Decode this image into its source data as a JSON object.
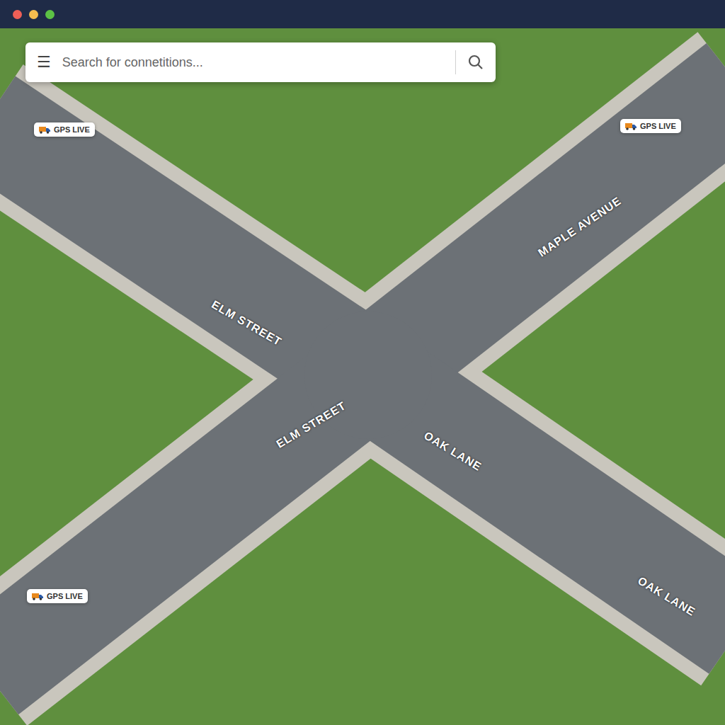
{
  "window": {
    "controls": [
      {
        "name": "close",
        "color": "#ee5f57"
      },
      {
        "name": "minimize",
        "color": "#f5bd4f"
      },
      {
        "name": "maximize",
        "color": "#5cc245"
      }
    ]
  },
  "search": {
    "menu": "☰",
    "placeholder": "Search for connetitions..."
  },
  "badges": [
    {
      "label": "GPS LIVE"
    },
    {
      "label": "GPS LIVE"
    },
    {
      "label": "GPS LIVE"
    }
  ],
  "streets": [
    {
      "label": "ELM STREET"
    },
    {
      "label": "ELM STREET"
    },
    {
      "label": "MAPLE AVENUE"
    },
    {
      "label": "OAK LANE"
    },
    {
      "label": "OAK LANE"
    }
  ]
}
